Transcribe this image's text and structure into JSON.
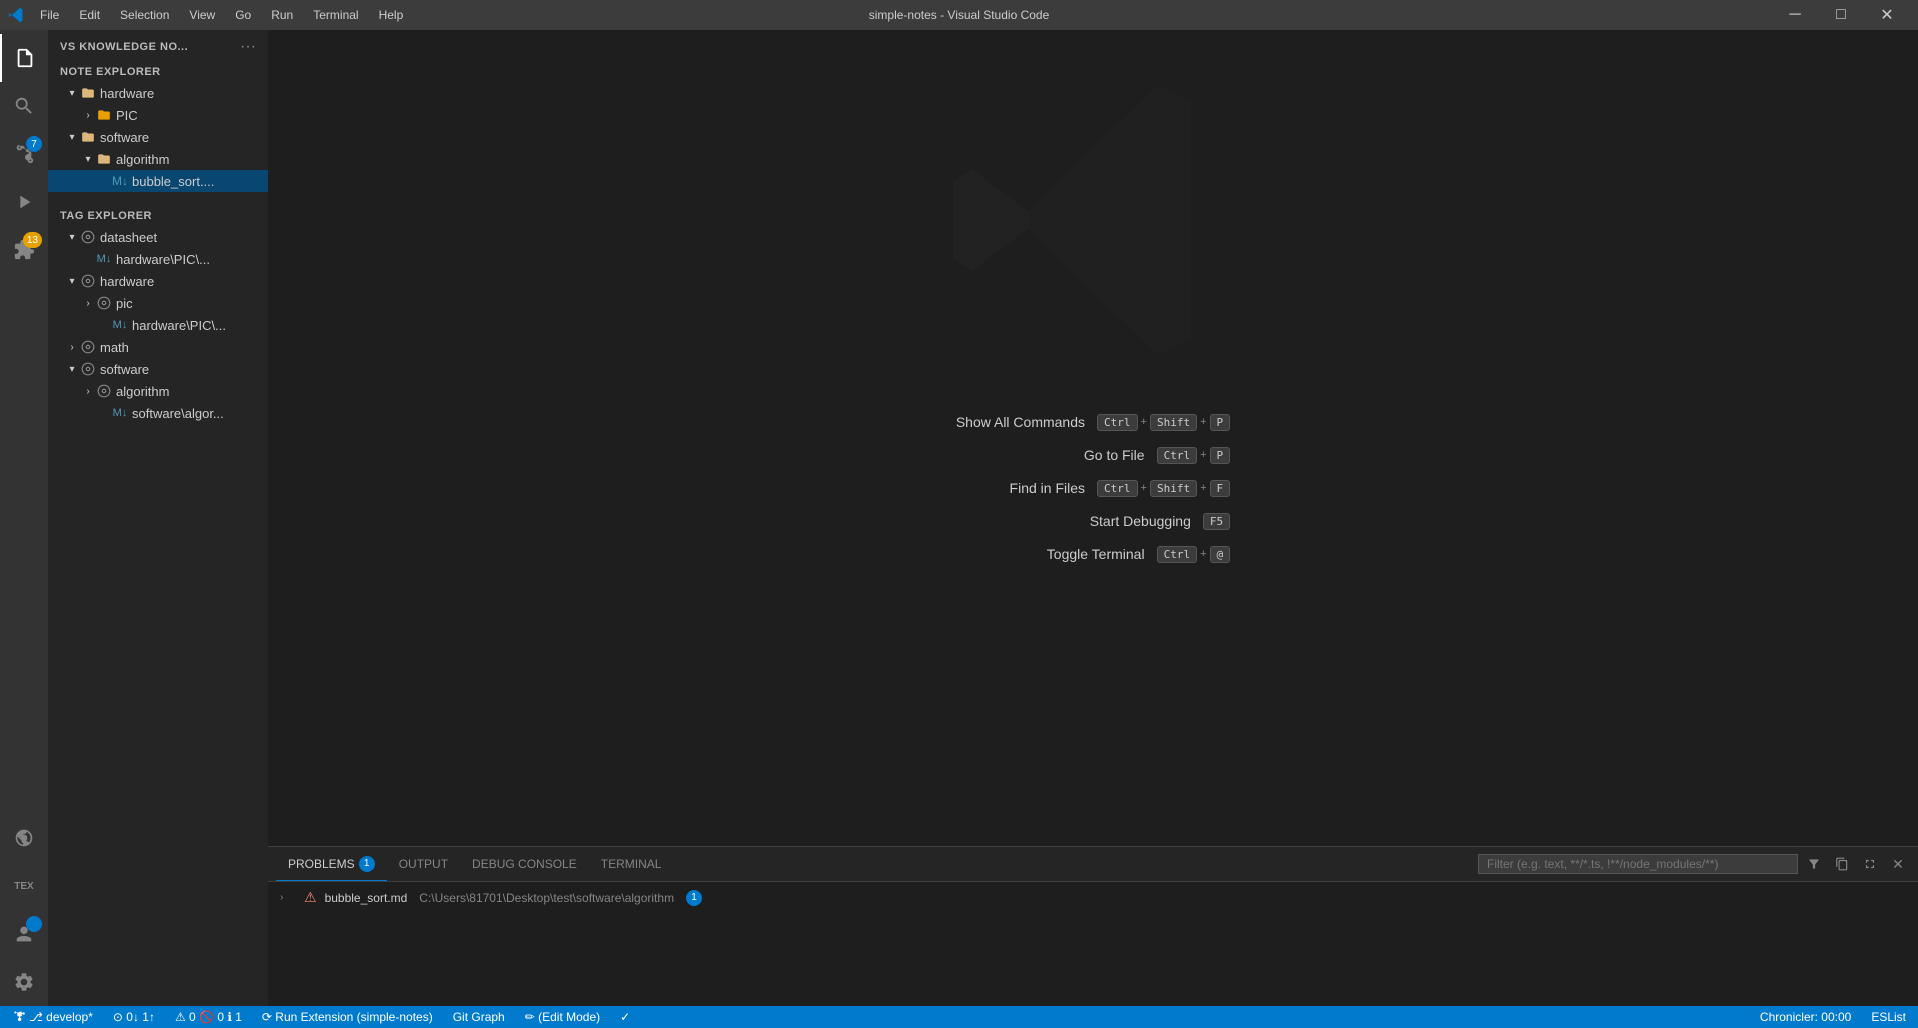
{
  "titlebar": {
    "title": "simple-notes - Visual Studio Code",
    "menu_items": [
      "File",
      "Edit",
      "Selection",
      "View",
      "Go",
      "Run",
      "Terminal",
      "Help"
    ],
    "controls": [
      "─",
      "□",
      "✕"
    ]
  },
  "activity_bar": {
    "items": [
      {
        "name": "explorer",
        "icon": "📄",
        "active": true
      },
      {
        "name": "search",
        "icon": "🔍",
        "active": false
      },
      {
        "name": "source-control",
        "icon": "⑂",
        "badge": "7",
        "active": false
      },
      {
        "name": "run-debug",
        "icon": "▷",
        "active": false
      },
      {
        "name": "extensions",
        "icon": "⊞",
        "badge": "13",
        "active": false
      }
    ],
    "bottom_items": [
      {
        "name": "remote",
        "icon": "⚙",
        "active": false
      },
      {
        "name": "tex",
        "icon": "TEX",
        "active": false
      },
      {
        "name": "account",
        "icon": "👤",
        "active": false
      },
      {
        "name": "settings",
        "icon": "⚙",
        "active": false
      }
    ]
  },
  "sidebar": {
    "workspace_title": "VS KNOWLEDGE NO...",
    "workspace_dots": "···",
    "note_explorer": {
      "section_label": "NOTE EXPLORER",
      "tree": [
        {
          "id": "hardware",
          "label": "hardware",
          "type": "folder",
          "indent": 1,
          "open": true
        },
        {
          "id": "pic",
          "label": "PIC",
          "type": "folder",
          "indent": 2,
          "open": false
        },
        {
          "id": "software",
          "label": "software",
          "type": "folder",
          "indent": 1,
          "open": true
        },
        {
          "id": "algorithm",
          "label": "algorithm",
          "type": "folder",
          "indent": 2,
          "open": true
        },
        {
          "id": "bubble_sort",
          "label": "bubble_sort....",
          "type": "file",
          "indent": 3,
          "selected": true
        }
      ]
    },
    "tag_explorer": {
      "section_label": "TAG EXPLORER",
      "tree": [
        {
          "id": "datasheet",
          "label": "datasheet",
          "type": "tag",
          "indent": 1,
          "open": true
        },
        {
          "id": "hardware_pic",
          "label": "hardware\\PIC\\...",
          "type": "file",
          "indent": 2
        },
        {
          "id": "hardware",
          "label": "hardware",
          "type": "tag",
          "indent": 1,
          "open": true
        },
        {
          "id": "pic",
          "label": "pic",
          "type": "tag",
          "indent": 2,
          "open": false
        },
        {
          "id": "hardware_pic2",
          "label": "hardware\\PIC\\...",
          "type": "file",
          "indent": 3
        },
        {
          "id": "math",
          "label": "math",
          "type": "tag",
          "indent": 1,
          "open": false
        },
        {
          "id": "software2",
          "label": "software",
          "type": "tag",
          "indent": 1,
          "open": true
        },
        {
          "id": "algorithm2",
          "label": "algorithm",
          "type": "tag",
          "indent": 2,
          "open": false
        },
        {
          "id": "software_algor",
          "label": "software\\algor...",
          "type": "file",
          "indent": 3
        }
      ]
    }
  },
  "welcome": {
    "commands": [
      {
        "label": "Show All Commands",
        "keys": [
          "Ctrl",
          "+",
          "Shift",
          "+",
          "P"
        ]
      },
      {
        "label": "Go to File",
        "keys": [
          "Ctrl",
          "+",
          "P"
        ]
      },
      {
        "label": "Find in Files",
        "keys": [
          "Ctrl",
          "+",
          "Shift",
          "+",
          "F"
        ]
      },
      {
        "label": "Start Debugging",
        "keys": [
          "F5"
        ]
      },
      {
        "label": "Toggle Terminal",
        "keys": [
          "Ctrl",
          "+",
          "@"
        ]
      }
    ]
  },
  "panel": {
    "tabs": [
      {
        "label": "PROBLEMS",
        "badge": "1",
        "active": true
      },
      {
        "label": "OUTPUT",
        "badge": null,
        "active": false
      },
      {
        "label": "DEBUG CONSOLE",
        "badge": null,
        "active": false
      },
      {
        "label": "TERMINAL",
        "badge": null,
        "active": false
      }
    ],
    "filter_placeholder": "Filter (e.g. text, **/*.ts, !**/node_modules/**)",
    "problems": [
      {
        "file": "bubble_sort.md",
        "path": "C:\\Users\\81701\\Desktop\\test\\software\\algorithm",
        "count": "1"
      }
    ]
  },
  "statusbar": {
    "left": [
      {
        "text": "⎇ develop*"
      },
      {
        "text": "⊙ 0↓ 1↑"
      },
      {
        "text": "⚠ 0 🚫 0 ℹ 1"
      },
      {
        "text": "⟳ Run Extension (simple-notes)"
      },
      {
        "text": "Git Graph"
      },
      {
        "text": "✏ (Edit Mode)"
      },
      {
        "text": "✓"
      }
    ],
    "right": [
      {
        "text": "Chronicler: 00:00"
      },
      {
        "text": "ESList"
      }
    ]
  }
}
